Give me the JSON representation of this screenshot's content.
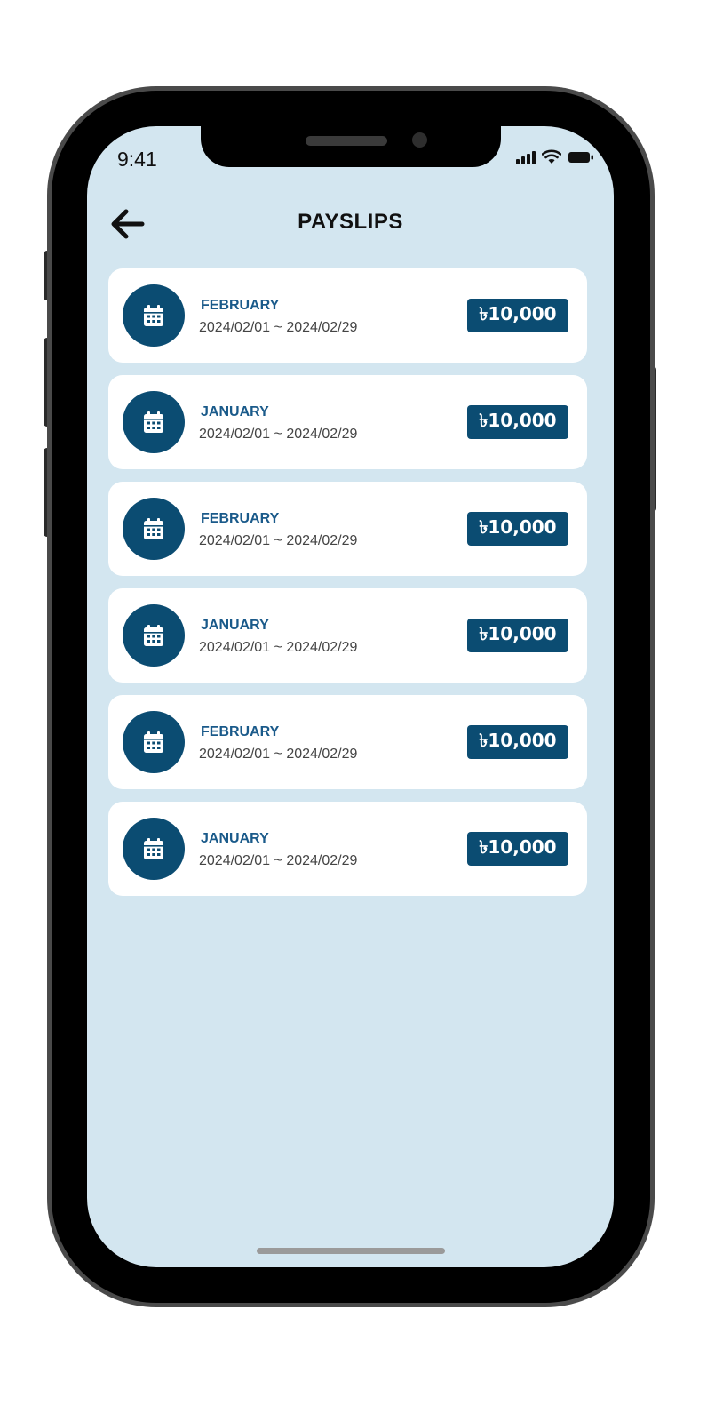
{
  "status_bar": {
    "time": "9:41",
    "icons": [
      "signal-icon",
      "wifi-icon",
      "battery-icon"
    ]
  },
  "header": {
    "back_icon": "arrow-left-icon",
    "title": "PAYSLIPS"
  },
  "payslips": [
    {
      "month": "FEBRUARY",
      "range": "2024/02/01 ~ 2024/02/29",
      "amount": "৳10,000",
      "icon": "calendar-icon"
    },
    {
      "month": "JANUARY",
      "range": "2024/02/01 ~ 2024/02/29",
      "amount": "৳10,000",
      "icon": "calendar-icon"
    },
    {
      "month": "FEBRUARY",
      "range": "2024/02/01 ~ 2024/02/29",
      "amount": "৳10,000",
      "icon": "calendar-icon"
    },
    {
      "month": "JANUARY",
      "range": "2024/02/01 ~ 2024/02/29",
      "amount": "৳10,000",
      "icon": "calendar-icon"
    },
    {
      "month": "FEBRUARY",
      "range": "2024/02/01 ~ 2024/02/29",
      "amount": "৳10,000",
      "icon": "calendar-icon"
    },
    {
      "month": "JANUARY",
      "range": "2024/02/01 ~ 2024/02/29",
      "amount": "৳10,000",
      "icon": "calendar-icon"
    }
  ],
  "colors": {
    "screen_bg": "#d3e6f0",
    "accent": "#0b4c72",
    "month_text": "#1a5a8a",
    "card_bg": "#ffffff"
  }
}
